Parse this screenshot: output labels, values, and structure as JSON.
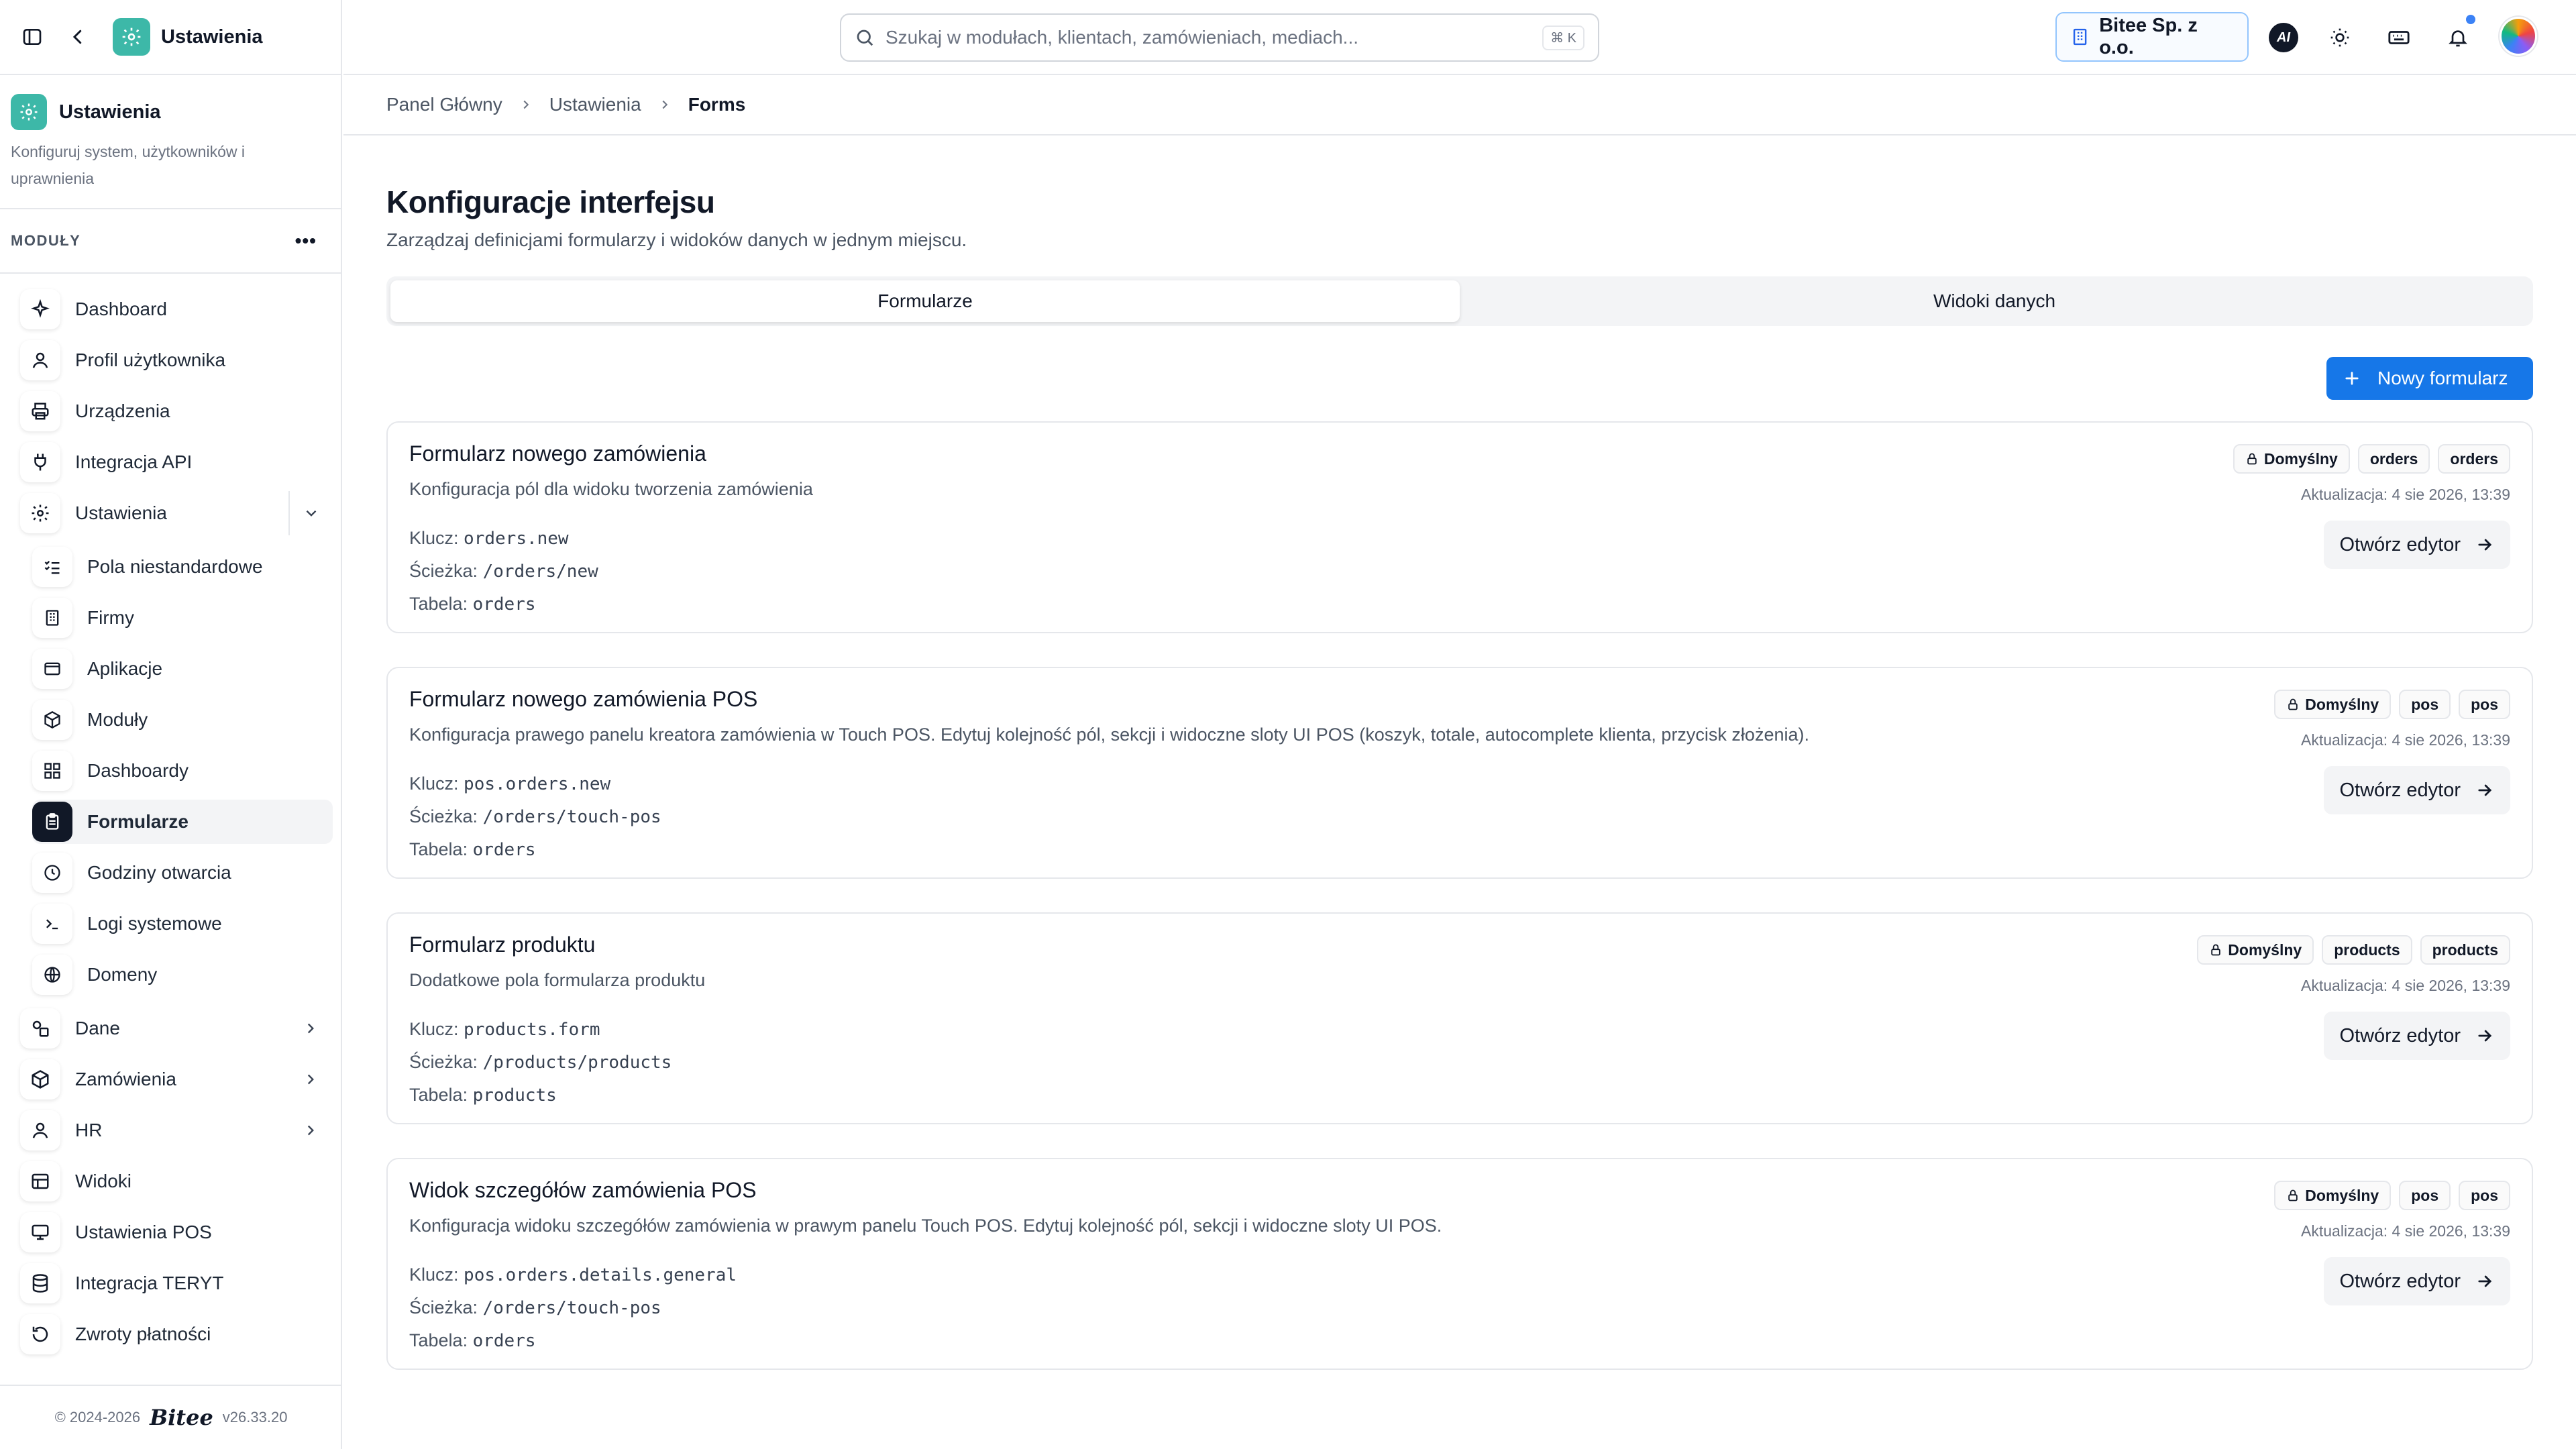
{
  "app": {
    "title": "Ustawienia"
  },
  "module": {
    "title": "Ustawienia",
    "description": "Konfiguruj system, użytkowników i uprawnienia"
  },
  "sidebar": {
    "section_label": "MODUŁY",
    "items": [
      {
        "label": "Dashboard",
        "icon": "sparkle-icon"
      },
      {
        "label": "Profil użytkownika",
        "icon": "user-icon"
      },
      {
        "label": "Urządzenia",
        "icon": "printer-icon"
      },
      {
        "label": "Integracja API",
        "icon": "plug-icon"
      },
      {
        "label": "Ustawienia",
        "icon": "gear-icon",
        "expanded": true
      },
      {
        "label": "Dane",
        "icon": "shapes-icon"
      },
      {
        "label": "Zamówienia",
        "icon": "box-icon"
      },
      {
        "label": "HR",
        "icon": "user-icon"
      },
      {
        "label": "Widoki",
        "icon": "table-icon"
      },
      {
        "label": "Ustawienia POS",
        "icon": "monitor-icon"
      },
      {
        "label": "Integracja TERYT",
        "icon": "database-icon"
      },
      {
        "label": "Zwroty płatności",
        "icon": "rotate-icon"
      }
    ],
    "subitems": [
      {
        "label": "Pola niestandardowe",
        "icon": "list-checks-icon"
      },
      {
        "label": "Firmy",
        "icon": "building-icon"
      },
      {
        "label": "Aplikacje",
        "icon": "app-window-icon"
      },
      {
        "label": "Moduły",
        "icon": "package-icon"
      },
      {
        "label": "Dashboardy",
        "icon": "grid-icon"
      },
      {
        "label": "Formularze",
        "icon": "clipboard-icon",
        "active": true
      },
      {
        "label": "Godziny otwarcia",
        "icon": "clock-icon"
      },
      {
        "label": "Logi systemowe",
        "icon": "terminal-icon"
      },
      {
        "label": "Domeny",
        "icon": "globe-icon"
      }
    ],
    "footer": {
      "copyright": "© 2024-2026",
      "brand": "Bitee",
      "version": "v26.33.20"
    }
  },
  "header": {
    "search_placeholder": "Szukaj w modułach, klientach, zamówieniach, mediach...",
    "search_shortcut": "⌘ K",
    "company": "Bitee Sp. z o.o.",
    "ai_label": "AI"
  },
  "breadcrumb": [
    "Panel Główny",
    "Ustawienia",
    "Forms"
  ],
  "page": {
    "title": "Konfiguracje interfejsu",
    "subtitle": "Zarządzaj definicjami formularzy i widoków danych w jednym miejscu.",
    "tabs": [
      {
        "label": "Formularze",
        "active": true
      },
      {
        "label": "Widoki danych",
        "active": false
      }
    ],
    "new_button": "Nowy formularz",
    "key_label": "Klucz:",
    "path_label": "Ścieżka:",
    "table_label": "Tabela:",
    "edit_label": "Otwórz edytor"
  },
  "forms": [
    {
      "title": "Formularz nowego zamówienia",
      "description": "Konfiguracja pól dla widoku tworzenia zamówienia",
      "key": "orders.new",
      "path": "/orders/new",
      "table": "orders",
      "badges": [
        "Domyślny",
        "orders",
        "orders"
      ],
      "updated": "Aktualizacja: 4 sie 2026, 13:39"
    },
    {
      "title": "Formularz nowego zamówienia POS",
      "description": "Konfiguracja prawego panelu kreatora zamówienia w Touch POS. Edytuj kolejność pól, sekcji i widoczne sloty UI POS (koszyk, totale, autocomplete klienta, przycisk złożenia).",
      "key": "pos.orders.new",
      "path": "/orders/touch-pos",
      "table": "orders",
      "badges": [
        "Domyślny",
        "pos",
        "pos"
      ],
      "updated": "Aktualizacja: 4 sie 2026, 13:39"
    },
    {
      "title": "Formularz produktu",
      "description": "Dodatkowe pola formularza produktu",
      "key": "products.form",
      "path": "/products/products",
      "table": "products",
      "badges": [
        "Domyślny",
        "products",
        "products"
      ],
      "updated": "Aktualizacja: 4 sie 2026, 13:39"
    },
    {
      "title": "Widok szczegółów zamówienia POS",
      "description": "Konfiguracja widoku szczegółów zamówienia w prawym panelu Touch POS. Edytuj kolejność pól, sekcji i widoczne sloty UI POS.",
      "key": "pos.orders.details.general",
      "path": "/orders/touch-pos",
      "table": "orders",
      "badges": [
        "Domyślny",
        "pos",
        "pos"
      ],
      "updated": "Aktualizacja: 4 sie 2026, 13:39"
    }
  ],
  "colors": {
    "accent": "#1677e8",
    "brand_teal": "#3db8a8",
    "border": "#e5e7eb",
    "active_bg": "#f3f4f6"
  }
}
